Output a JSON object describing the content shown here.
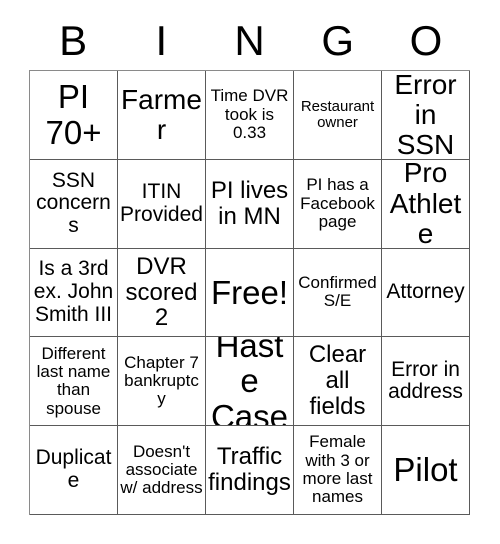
{
  "card": {
    "headers": [
      "B",
      "I",
      "N",
      "G",
      "O"
    ],
    "rows": [
      [
        {
          "text": "PI 70+",
          "size": "fs-xxl"
        },
        {
          "text": "Farmer",
          "size": "fs-xl"
        },
        {
          "text": "Time DVR took is 0.33",
          "size": "fs-sm"
        },
        {
          "text": "Restaurant owner",
          "size": "fs-xs"
        },
        {
          "text": "Error in SSN",
          "size": "fs-xl"
        }
      ],
      [
        {
          "text": "SSN concerns",
          "size": "fs-md"
        },
        {
          "text": "ITIN Provided",
          "size": "fs-md"
        },
        {
          "text": "PI lives in MN",
          "size": "fs-lg"
        },
        {
          "text": "PI has a Facebook page",
          "size": "fs-sm"
        },
        {
          "text": "Pro Athlete",
          "size": "fs-xl"
        }
      ],
      [
        {
          "text": "Is a 3rd ex. John Smith III",
          "size": "fs-md"
        },
        {
          "text": "DVR scored 2",
          "size": "fs-lg"
        },
        {
          "text": "Free!",
          "size": "fs-xxl"
        },
        {
          "text": "Confirmed S/E",
          "size": "fs-sm"
        },
        {
          "text": "Attorney",
          "size": "fs-md"
        }
      ],
      [
        {
          "text": "Different last name than spouse",
          "size": "fs-sm"
        },
        {
          "text": "Chapter 7 bankruptcy",
          "size": "fs-sm"
        },
        {
          "text": "Haste Case",
          "size": "fs-xxl"
        },
        {
          "text": "Clear all fields",
          "size": "fs-lg"
        },
        {
          "text": "Error in address",
          "size": "fs-md"
        }
      ],
      [
        {
          "text": "Duplicate",
          "size": "fs-md"
        },
        {
          "text": "Doesn't associate w/ address",
          "size": "fs-sm"
        },
        {
          "text": "Traffic findings",
          "size": "fs-lg"
        },
        {
          "text": "Female with 3 or more last names",
          "size": "fs-sm"
        },
        {
          "text": "Pilot",
          "size": "fs-xxl"
        }
      ]
    ]
  }
}
